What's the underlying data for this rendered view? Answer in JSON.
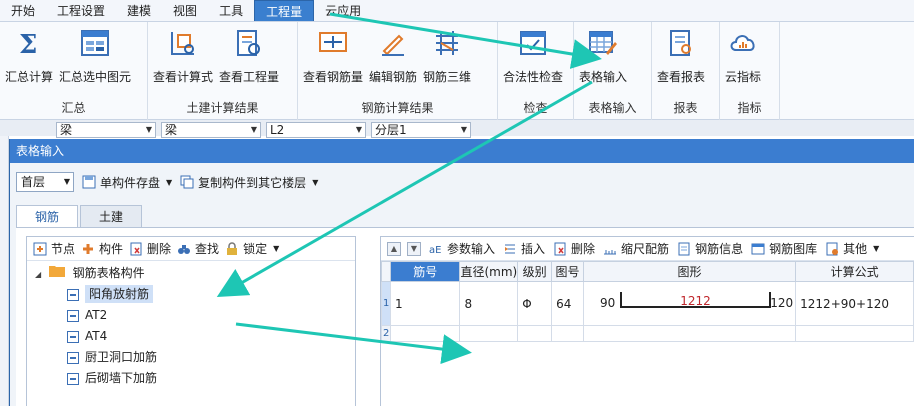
{
  "menu": [
    "开始",
    "工程设置",
    "建模",
    "视图",
    "工具",
    "工程量",
    "云应用"
  ],
  "ribbon": {
    "groups": [
      {
        "title": "汇总",
        "buttons": [
          "汇总计算",
          "汇总选中图元"
        ]
      },
      {
        "title": "土建计算结果",
        "buttons": [
          "查看计算式",
          "查看工程量"
        ]
      },
      {
        "title": "钢筋计算结果",
        "buttons": [
          "查看钢筋量",
          "编辑钢筋",
          "钢筋三维"
        ]
      },
      {
        "title": "检查",
        "buttons": [
          "合法性检查"
        ]
      },
      {
        "title": "表格输入",
        "buttons": [
          "表格输入"
        ]
      },
      {
        "title": "报表",
        "buttons": [
          "查看报表"
        ]
      },
      {
        "title": "指标",
        "buttons": [
          "云指标"
        ]
      }
    ]
  },
  "props": {
    "type1": "梁",
    "type2": "梁",
    "name": "L2",
    "layer": "分层1"
  },
  "dialog": {
    "title": "表格输入",
    "floor": "首层",
    "save_label": "单构件存盘",
    "copy_label": "复制构件到其它楼层",
    "tabs": [
      "钢筋",
      "土建"
    ]
  },
  "tree": {
    "toolbar": [
      "节点",
      "构件",
      "删除",
      "查找",
      "锁定"
    ],
    "root": "钢筋表格构件",
    "children": [
      "阳角放射筋",
      "AT2",
      "AT4",
      "厨卫洞口加筋",
      "后砌墙下加筋"
    ]
  },
  "grid": {
    "toolbar": [
      "参数输入",
      "插入",
      "删除",
      "缩尺配筋",
      "钢筋信息",
      "钢筋图库",
      "其他"
    ],
    "headers": [
      "筋号",
      "直径(mm)",
      "级别",
      "图号",
      "图形",
      "计算公式"
    ],
    "rows": [
      {
        "num": "1",
        "jinhao": "1",
        "diameter": "8",
        "grade": "Φ",
        "tuhao": "64",
        "shape_left": "90",
        "shape_mid": "1212",
        "shape_right": "120",
        "formula": "1212+90+120"
      },
      {
        "num": "2"
      }
    ]
  },
  "colors": {
    "accent": "#3b7dd0",
    "arrow": "#1ec6b4",
    "shape_text": "#c0282d"
  }
}
